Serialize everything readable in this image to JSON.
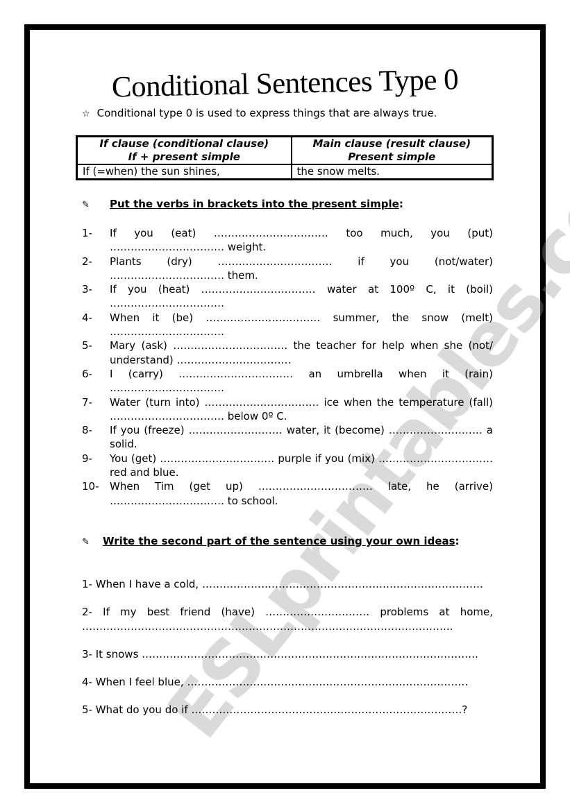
{
  "title": "Conditional Sentences Type 0",
  "intro": {
    "icon": "star-icon",
    "text": "Conditional type 0 is used to express things that are always true."
  },
  "table": {
    "headers": [
      {
        "line1": "If clause (conditional clause)",
        "line2": "If + present simple"
      },
      {
        "line1": "Main clause (result clause)",
        "line2": "Present simple"
      }
    ],
    "example": [
      "If (=when) the sun shines,",
      "the snow melts."
    ]
  },
  "exercise1": {
    "icon": "pencil-icon",
    "heading": "Put the verbs in brackets into the present simple",
    "heading_suffix": ":",
    "items": [
      {
        "num": "1-",
        "text": "If you (eat) …………………………… too much, you (put) …………………………… weight."
      },
      {
        "num": "2-",
        "text": "Plants (dry) …………………………… if you (not/water) …………………………… them."
      },
      {
        "num": "3-",
        "text": "If you (heat) …………………………… water at 100º C, it (boil) ……………………………"
      },
      {
        "num": "4-",
        "text": "When it (be) …………………………… summer, the snow (melt) ……………………………"
      },
      {
        "num": "5-",
        "text": "Mary (ask) …………………………… the teacher for help when she (not/ understand) ……………………………"
      },
      {
        "num": "6-",
        "text": "I (carry) …………………………… an umbrella when it (rain) ……………………………"
      },
      {
        "num": "7-",
        "text": "Water (turn into) …………………………… ice when the temperature (fall) …………………………… below 0º C."
      },
      {
        "num": "8-",
        "text": "If you (freeze) ……………………… water, it (become) ……………………… a solid."
      },
      {
        "num": "9-",
        "text": "You (get) …………………………… purple if you (mix) …………………………… red and blue."
      },
      {
        "num": "10-",
        "text": "When Tim (get up) …………………………… late, he (arrive) …………………………… to school."
      }
    ]
  },
  "exercise2": {
    "icon": "pencil-icon",
    "heading": "Write the second part of the sentence using your own ideas",
    "heading_suffix": ":",
    "items": [
      "1- When I have a cold, ………………………………………………………………………",
      "2- If my best friend (have) ………………………… problems at home, ……………………………………………………………………………………………..",
      "3- It snows …………………………………………………………………………………….",
      "4- When I feel blue, ………………………………………………………………………",
      "5- What do you do if ……………………………………………………………………?"
    ]
  },
  "watermark": "ESLprintables.com"
}
